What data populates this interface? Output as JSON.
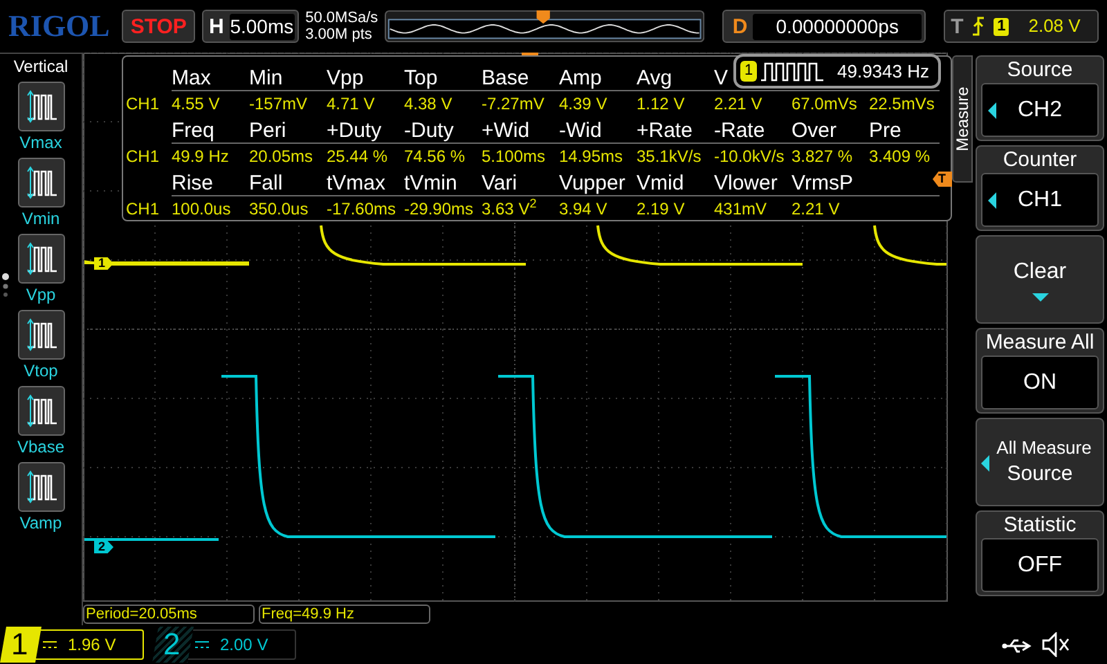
{
  "header": {
    "logo": "RIGOL",
    "run_state": "STOP",
    "timebase": {
      "label": "H",
      "value": "5.00ms"
    },
    "sample_rate": "50.0MSa/s",
    "memory_depth": "3.00M pts",
    "delay": {
      "label": "D",
      "value": "0.00000000ps"
    },
    "trigger": {
      "label": "T",
      "source": "1",
      "level": "2.08 V"
    }
  },
  "left_panel": {
    "title": "Vertical",
    "items": [
      {
        "label": "Vmax"
      },
      {
        "label": "Vmin"
      },
      {
        "label": "Vpp"
      },
      {
        "label": "Vtop"
      },
      {
        "label": "Vbase"
      },
      {
        "label": "Vamp"
      }
    ]
  },
  "measurements": {
    "groups": [
      {
        "headers": [
          "Max",
          "Min",
          "Vpp",
          "Top",
          "Base",
          "Amp",
          "Avg",
          "V"
        ],
        "rows": [
          {
            "channel": "CH1",
            "values": [
              "4.55 V",
              "-157mV",
              "4.71 V",
              "4.38 V",
              "-7.27mV",
              "4.39 V",
              "1.12 V",
              "2.21 V",
              "67.0mVs",
              "22.5mVs"
            ]
          }
        ]
      },
      {
        "headers": [
          "Freq",
          "Peri",
          "+Duty",
          "-Duty",
          "+Wid",
          "-Wid",
          "+Rate",
          "-Rate",
          "Over",
          "Pre"
        ],
        "rows": [
          {
            "channel": "CH1",
            "values": [
              "49.9 Hz",
              "20.05ms",
              "25.44 %",
              "74.56 %",
              "5.100ms",
              "14.95ms",
              "35.1kV/s",
              "-10.0kV/s",
              "3.827 %",
              "3.409 %"
            ]
          }
        ]
      },
      {
        "headers": [
          "Rise",
          "Fall",
          "tVmax",
          "tVmin",
          "Vari",
          "Vupper",
          "Vmid",
          "Vlower",
          "VrmsP"
        ],
        "rows": [
          {
            "channel": "CH1",
            "values": [
              "100.0us",
              "350.0us",
              "-17.60ms",
              "-29.90ms",
              "3.63 V$^{2}$",
              "3.94 V",
              "2.19 V",
              "431mV",
              "2.21 V"
            ]
          }
        ]
      }
    ]
  },
  "trigger_level_marker": "T",
  "counter": {
    "channel": "1",
    "frequency": "49.9343 Hz"
  },
  "traces": [
    {
      "marker": "1",
      "color": "#e6e600"
    },
    {
      "marker": "2",
      "color": "#00c8d2"
    }
  ],
  "cursor_readouts": [
    "Period=20.05ms",
    "Freq=49.9 Hz"
  ],
  "menu": {
    "tab": "Measure",
    "items": [
      {
        "kind": "select",
        "title": "Source",
        "value": "CH2"
      },
      {
        "kind": "select",
        "title": "Counter",
        "value": "CH1"
      },
      {
        "kind": "action",
        "label": "Clear"
      },
      {
        "kind": "toggle",
        "title": "Measure All",
        "value": "ON"
      },
      {
        "kind": "submenu",
        "label": "All Measure",
        "sublabel": "Source"
      },
      {
        "kind": "toggle",
        "title": "Statistic",
        "value": "OFF"
      }
    ]
  },
  "channels": [
    {
      "number": "1",
      "scale": "1.96 V",
      "selected": true
    },
    {
      "number": "2",
      "scale": "2.00 V",
      "selected": false
    }
  ]
}
